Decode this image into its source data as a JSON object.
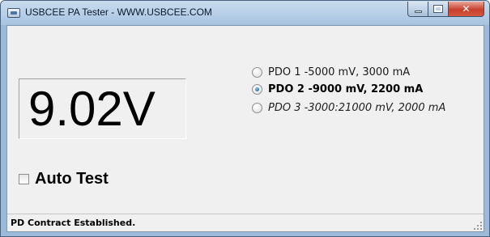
{
  "window": {
    "title": "USBCEE PA Tester - WWW.USBCEE.COM",
    "controls": {
      "minimize": "minimize-icon",
      "maximize": "maximize-icon",
      "close": "close-icon",
      "close_glyph": "✕"
    }
  },
  "display": {
    "voltage": "9.02V"
  },
  "pdo_options": [
    {
      "label": "PDO 1 -5000 mV, 3000 mA",
      "selected": false,
      "style": "normal"
    },
    {
      "label": "PDO 2 -9000 mV, 2200 mA",
      "selected": true,
      "style": "bold"
    },
    {
      "label": "PDO 3 -3000:21000 mV, 2000 mA",
      "selected": false,
      "style": "italic"
    }
  ],
  "auto_test": {
    "label": "Auto Test",
    "checked": false
  },
  "status_bar": {
    "text": "PD Contract Established."
  },
  "colors": {
    "close_button": "#c7412d",
    "titlebar": "#b8d0e8",
    "client_bg": "#f0f0f0"
  }
}
